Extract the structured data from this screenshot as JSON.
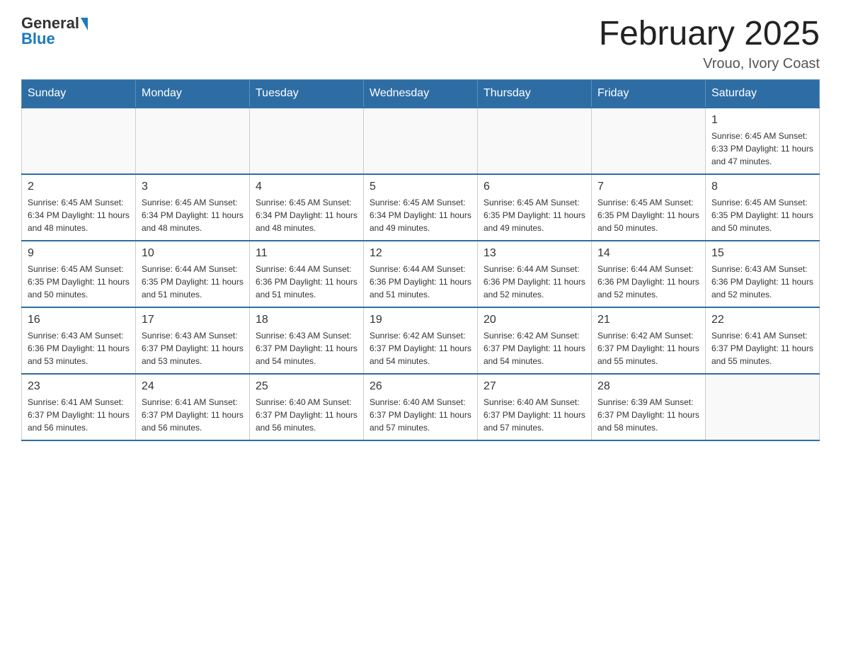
{
  "header": {
    "logo_general": "General",
    "logo_blue": "Blue",
    "month_title": "February 2025",
    "location": "Vrouo, Ivory Coast"
  },
  "days_of_week": [
    "Sunday",
    "Monday",
    "Tuesday",
    "Wednesday",
    "Thursday",
    "Friday",
    "Saturday"
  ],
  "weeks": [
    [
      {
        "day": "",
        "info": ""
      },
      {
        "day": "",
        "info": ""
      },
      {
        "day": "",
        "info": ""
      },
      {
        "day": "",
        "info": ""
      },
      {
        "day": "",
        "info": ""
      },
      {
        "day": "",
        "info": ""
      },
      {
        "day": "1",
        "info": "Sunrise: 6:45 AM\nSunset: 6:33 PM\nDaylight: 11 hours\nand 47 minutes."
      }
    ],
    [
      {
        "day": "2",
        "info": "Sunrise: 6:45 AM\nSunset: 6:34 PM\nDaylight: 11 hours\nand 48 minutes."
      },
      {
        "day": "3",
        "info": "Sunrise: 6:45 AM\nSunset: 6:34 PM\nDaylight: 11 hours\nand 48 minutes."
      },
      {
        "day": "4",
        "info": "Sunrise: 6:45 AM\nSunset: 6:34 PM\nDaylight: 11 hours\nand 48 minutes."
      },
      {
        "day": "5",
        "info": "Sunrise: 6:45 AM\nSunset: 6:34 PM\nDaylight: 11 hours\nand 49 minutes."
      },
      {
        "day": "6",
        "info": "Sunrise: 6:45 AM\nSunset: 6:35 PM\nDaylight: 11 hours\nand 49 minutes."
      },
      {
        "day": "7",
        "info": "Sunrise: 6:45 AM\nSunset: 6:35 PM\nDaylight: 11 hours\nand 50 minutes."
      },
      {
        "day": "8",
        "info": "Sunrise: 6:45 AM\nSunset: 6:35 PM\nDaylight: 11 hours\nand 50 minutes."
      }
    ],
    [
      {
        "day": "9",
        "info": "Sunrise: 6:45 AM\nSunset: 6:35 PM\nDaylight: 11 hours\nand 50 minutes."
      },
      {
        "day": "10",
        "info": "Sunrise: 6:44 AM\nSunset: 6:35 PM\nDaylight: 11 hours\nand 51 minutes."
      },
      {
        "day": "11",
        "info": "Sunrise: 6:44 AM\nSunset: 6:36 PM\nDaylight: 11 hours\nand 51 minutes."
      },
      {
        "day": "12",
        "info": "Sunrise: 6:44 AM\nSunset: 6:36 PM\nDaylight: 11 hours\nand 51 minutes."
      },
      {
        "day": "13",
        "info": "Sunrise: 6:44 AM\nSunset: 6:36 PM\nDaylight: 11 hours\nand 52 minutes."
      },
      {
        "day": "14",
        "info": "Sunrise: 6:44 AM\nSunset: 6:36 PM\nDaylight: 11 hours\nand 52 minutes."
      },
      {
        "day": "15",
        "info": "Sunrise: 6:43 AM\nSunset: 6:36 PM\nDaylight: 11 hours\nand 52 minutes."
      }
    ],
    [
      {
        "day": "16",
        "info": "Sunrise: 6:43 AM\nSunset: 6:36 PM\nDaylight: 11 hours\nand 53 minutes."
      },
      {
        "day": "17",
        "info": "Sunrise: 6:43 AM\nSunset: 6:37 PM\nDaylight: 11 hours\nand 53 minutes."
      },
      {
        "day": "18",
        "info": "Sunrise: 6:43 AM\nSunset: 6:37 PM\nDaylight: 11 hours\nand 54 minutes."
      },
      {
        "day": "19",
        "info": "Sunrise: 6:42 AM\nSunset: 6:37 PM\nDaylight: 11 hours\nand 54 minutes."
      },
      {
        "day": "20",
        "info": "Sunrise: 6:42 AM\nSunset: 6:37 PM\nDaylight: 11 hours\nand 54 minutes."
      },
      {
        "day": "21",
        "info": "Sunrise: 6:42 AM\nSunset: 6:37 PM\nDaylight: 11 hours\nand 55 minutes."
      },
      {
        "day": "22",
        "info": "Sunrise: 6:41 AM\nSunset: 6:37 PM\nDaylight: 11 hours\nand 55 minutes."
      }
    ],
    [
      {
        "day": "23",
        "info": "Sunrise: 6:41 AM\nSunset: 6:37 PM\nDaylight: 11 hours\nand 56 minutes."
      },
      {
        "day": "24",
        "info": "Sunrise: 6:41 AM\nSunset: 6:37 PM\nDaylight: 11 hours\nand 56 minutes."
      },
      {
        "day": "25",
        "info": "Sunrise: 6:40 AM\nSunset: 6:37 PM\nDaylight: 11 hours\nand 56 minutes."
      },
      {
        "day": "26",
        "info": "Sunrise: 6:40 AM\nSunset: 6:37 PM\nDaylight: 11 hours\nand 57 minutes."
      },
      {
        "day": "27",
        "info": "Sunrise: 6:40 AM\nSunset: 6:37 PM\nDaylight: 11 hours\nand 57 minutes."
      },
      {
        "day": "28",
        "info": "Sunrise: 6:39 AM\nSunset: 6:37 PM\nDaylight: 11 hours\nand 58 minutes."
      },
      {
        "day": "",
        "info": ""
      }
    ]
  ]
}
